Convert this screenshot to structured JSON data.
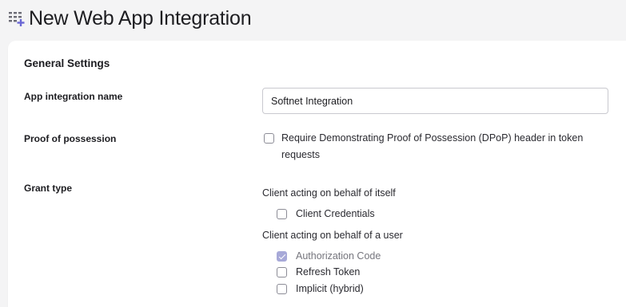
{
  "header": {
    "title": "New Web App Integration",
    "icon": "grid-plus-icon"
  },
  "section": {
    "title": "General Settings"
  },
  "app_name": {
    "label": "App integration name",
    "value": "Softnet Integration"
  },
  "proof": {
    "label": "Proof of possession",
    "checkbox_label": "Require Demonstrating Proof of Possession (DPoP) header in token requests",
    "checked": false
  },
  "grant": {
    "label": "Grant type",
    "groups": [
      {
        "label": "Client acting on behalf of itself",
        "options": [
          {
            "label": "Client Credentials",
            "checked": false,
            "disabled": false
          }
        ]
      },
      {
        "label": "Client acting on behalf of a user",
        "options": [
          {
            "label": "Authorization Code",
            "checked": true,
            "disabled": true
          },
          {
            "label": "Refresh Token",
            "checked": false,
            "disabled": false
          },
          {
            "label": "Implicit (hybrid)",
            "checked": false,
            "disabled": false
          }
        ]
      }
    ]
  },
  "colors": {
    "background": "#f4f4f5",
    "card": "#ffffff",
    "checked_accent": "#a7a9d8",
    "icon_accent": "#6a67d4"
  }
}
